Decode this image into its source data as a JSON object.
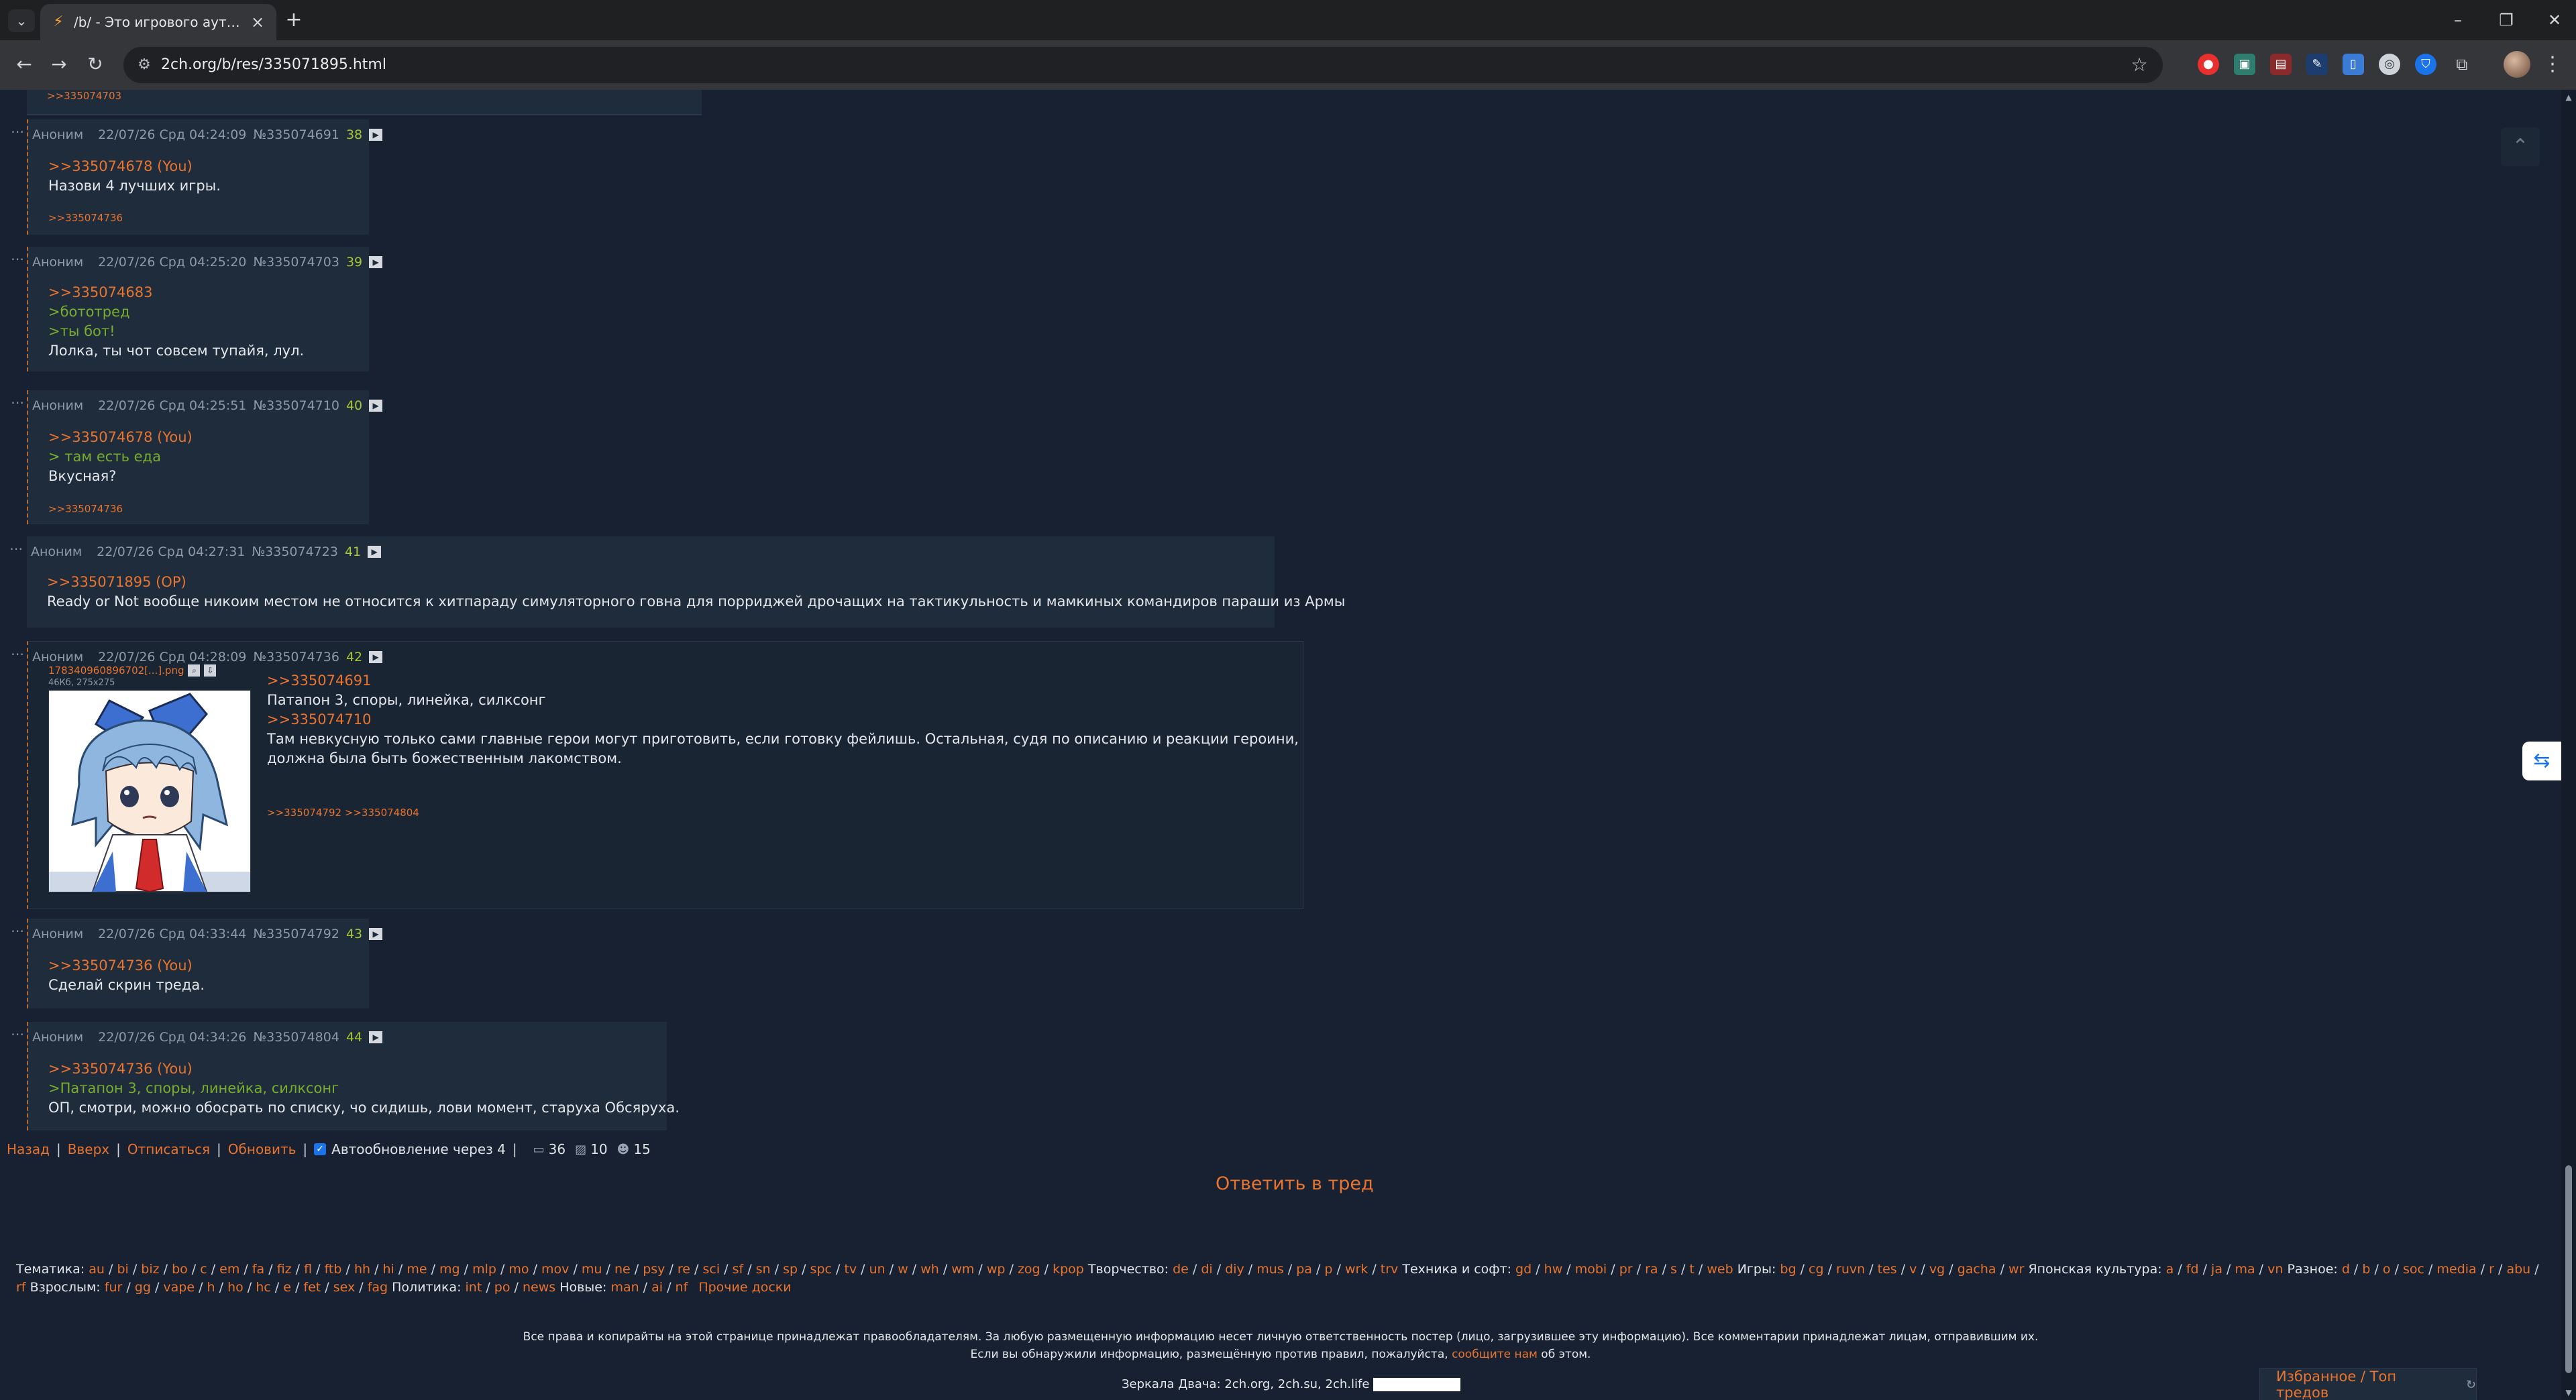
{
  "browser": {
    "tab_title": "/b/ - Это игрового аутизма тр",
    "url": "2ch.org/b/res/335071895.html"
  },
  "page": {
    "prev_ref": ">>335074703",
    "posts": [
      {
        "name": "Аноним",
        "date": "22/07/26 Срд 04:24:09",
        "num": "№335074691",
        "count": "38",
        "lines": [
          {
            "type": "ref",
            "text": ">>335074678 (You)"
          },
          {
            "type": "text",
            "text": "Назови 4 лучших игры."
          }
        ],
        "replies": ">>335074736"
      },
      {
        "name": "Аноним",
        "date": "22/07/26 Срд 04:25:20",
        "num": "№335074703",
        "count": "39",
        "lines": [
          {
            "type": "ref",
            "text": ">>335074683"
          },
          {
            "type": "quote",
            "text": ">бототред"
          },
          {
            "type": "quote",
            "text": ">ты бот!"
          },
          {
            "type": "text",
            "text": "Лолка, ты чот совсем тупайя, лул."
          }
        ],
        "replies": ""
      },
      {
        "name": "Аноним",
        "date": "22/07/26 Срд 04:25:51",
        "num": "№335074710",
        "count": "40",
        "lines": [
          {
            "type": "ref",
            "text": ">>335074678 (You)"
          },
          {
            "type": "quote",
            "text": "> там есть еда"
          },
          {
            "type": "text",
            "text": "Вкусная?"
          }
        ],
        "replies": ">>335074736"
      },
      {
        "name": "Аноним",
        "date": "22/07/26 Срд 04:27:31",
        "num": "№335074723",
        "count": "41",
        "lines": [
          {
            "type": "ref",
            "text": ">>335071895 (OP)"
          },
          {
            "type": "text",
            "text": "Ready or Not вообще никоим местом не относится к хитпараду симуляторного говна для порриджей дрочащих на тактикульность и мамкиных командиров параши из Армы"
          }
        ],
        "replies": ""
      },
      {
        "name": "Аноним",
        "date": "22/07/26 Срд 04:28:09",
        "num": "№335074736",
        "count": "42",
        "file_name": "17834096089670​2[...].png",
        "file_meta": "46Кб, 275x275",
        "lines": [
          {
            "type": "ref",
            "text": ">>335074691"
          },
          {
            "type": "text",
            "text": "Патапон 3, споры, линейка, силксонг"
          },
          {
            "type": "ref",
            "text": ">>335074710"
          },
          {
            "type": "text",
            "text": "Там невкусную только сами главные герои могут приготовить, если готовку фейлишь. Остальная, судя по описанию и реакции героини,"
          },
          {
            "type": "text",
            "text": "должна была быть божественным лакомством."
          }
        ],
        "replies": ">>335074792 >>335074804"
      },
      {
        "name": "Аноним",
        "date": "22/07/26 Срд 04:33:44",
        "num": "№335074792",
        "count": "43",
        "lines": [
          {
            "type": "ref",
            "text": ">>335074736 (You)"
          },
          {
            "type": "text",
            "text": "Сделай скрин треда."
          }
        ],
        "replies": ""
      },
      {
        "name": "Аноним",
        "date": "22/07/26 Срд 04:34:26",
        "num": "№335074804",
        "count": "44",
        "lines": [
          {
            "type": "ref",
            "text": ">>335074736 (You)"
          },
          {
            "type": "quote",
            "text": ">Патапон 3, споры, линейка, силксонг"
          },
          {
            "type": "text",
            "text": "ОП, смотри, можно обосрать по списку, чо сидишь, лови момент, старуха Обсяруха."
          }
        ],
        "replies": ""
      }
    ],
    "bottom_links": {
      "back": "Назад",
      "up": "Вверх",
      "unsubscribe": "Отписаться",
      "refresh": "Обновить",
      "autoupdate": "Автообновление через 4",
      "posts_count": "36",
      "files_count": "10",
      "posters_count": "15"
    },
    "reply_to_thread": "Ответить в тред",
    "boards_nav": [
      {
        "type": "cat",
        "text": "Тематика:"
      },
      {
        "type": "list",
        "items": [
          "au",
          "bi",
          "biz",
          "bo",
          "c",
          "em",
          "fa",
          "fiz",
          "fl",
          "ftb",
          "hh",
          "hi",
          "me",
          "mg",
          "mlp",
          "mo",
          "mov",
          "mu",
          "ne",
          "psy",
          "re",
          "sci",
          "sf",
          "sn",
          "sp",
          "spc",
          "tv",
          "un",
          "w",
          "wh",
          "wm",
          "wp",
          "zog",
          "kpop"
        ]
      },
      {
        "type": "cat",
        "text": "Творчество:"
      },
      {
        "type": "list",
        "items": [
          "de",
          "di",
          "diy",
          "mus",
          "pa",
          "p",
          "wrk",
          "trv"
        ]
      },
      {
        "type": "cat",
        "text": "Техника и софт:"
      },
      {
        "type": "list",
        "items": [
          "gd",
          "hw",
          "mobi",
          "pr",
          "ra",
          "s",
          "t",
          "web"
        ]
      },
      {
        "type": "cat",
        "text": "Игры:"
      },
      {
        "type": "list",
        "items": [
          "bg",
          "cg",
          "ruvn",
          "tes",
          "v",
          "vg",
          "gacha",
          "wr"
        ]
      },
      {
        "type": "cat",
        "text": "Японская культура:"
      },
      {
        "type": "list",
        "items": [
          "a",
          "fd",
          "ja",
          "ma",
          "vn"
        ]
      },
      {
        "type": "cat",
        "text": "Разное:"
      },
      {
        "type": "list",
        "items": [
          "d",
          "b",
          "o",
          "soc",
          "media",
          "r",
          "abu",
          "rf"
        ]
      },
      {
        "type": "cat",
        "text": "Взрослым:"
      },
      {
        "type": "list",
        "items": [
          "fur",
          "gg",
          "vape",
          "h",
          "ho",
          "hc",
          "e",
          "fet",
          "sex",
          "fag"
        ]
      },
      {
        "type": "cat",
        "text": "Политика:"
      },
      {
        "type": "list",
        "items": [
          "int",
          "po",
          "news"
        ]
      },
      {
        "type": "cat",
        "text": "Новые:"
      },
      {
        "type": "list",
        "items": [
          "man",
          "ai",
          "nf"
        ]
      },
      {
        "type": "other",
        "text": "Прочие доски"
      }
    ],
    "copyright_line1": "Все права и копирайты на этой странице принадлежат правообладателям. За любую размещенную информацию несет личную ответственность постер (лицо, загрузившее эту информацию). Все комментарии принадлежат лицам, отправившим их.",
    "copyright_line2_prefix": "Если вы обнаружили информацию, размещённую против правил, пожалуйста,",
    "copyright_line2_link": "сообщите нам",
    "copyright_line2_suffix": "об этом.",
    "mirrors": "Зеркала Двача: 2ch.org, 2ch.su, 2ch.life",
    "favorites": "Избранное / Топ тредов"
  }
}
